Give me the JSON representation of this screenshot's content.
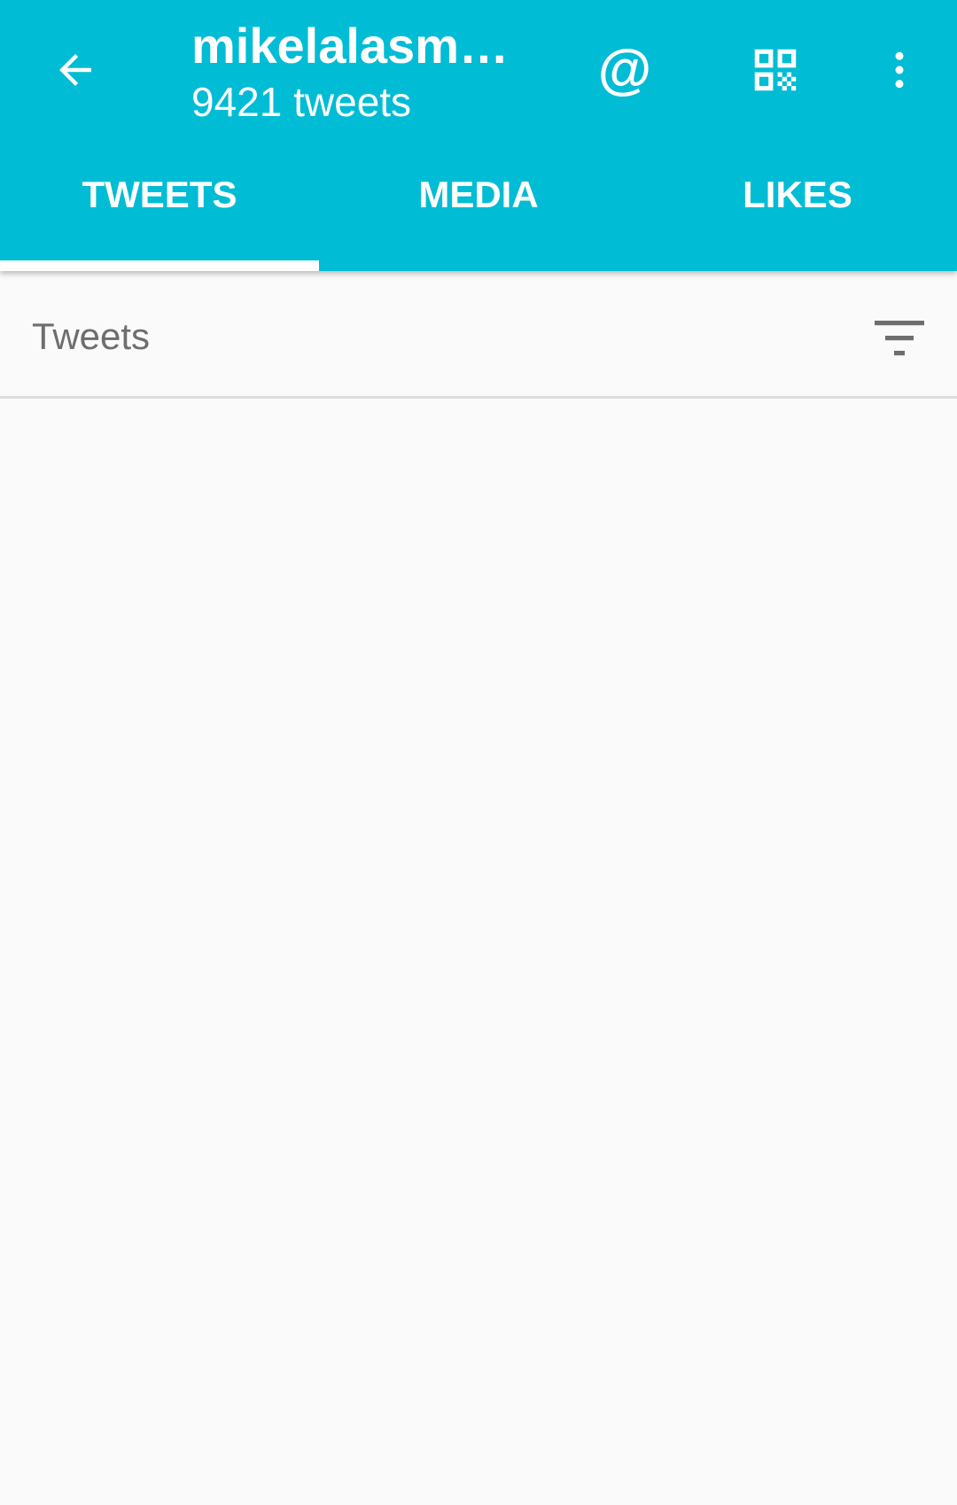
{
  "colors": {
    "app_bar": "#00bcd4",
    "on_app_bar": "#ffffff",
    "background": "#fafafa",
    "section_text": "#6e6e6e",
    "divider": "#dcdcdc"
  },
  "toolbar": {
    "back_icon": "arrow-left-icon",
    "title": "mikelalasmu…",
    "subtitle": "9421 tweets",
    "mention_label": "@",
    "mention_icon": "at-sign-icon",
    "qr_icon": "qr-code-icon",
    "more_icon": "more-vertical-icon"
  },
  "tabs": [
    {
      "label": "TWEETS",
      "active": true
    },
    {
      "label": "MEDIA",
      "active": false
    },
    {
      "label": "LIKES",
      "active": false
    }
  ],
  "section": {
    "title": "Tweets",
    "filter_icon": "filter-icon"
  }
}
